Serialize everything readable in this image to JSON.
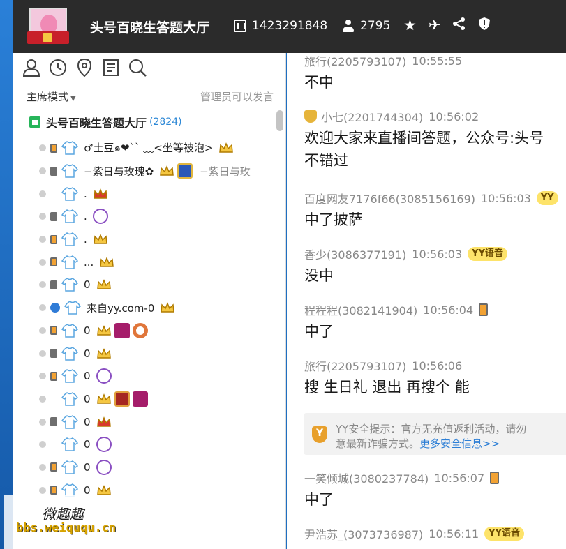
{
  "header": {
    "title": "头号百晓生答题大厅",
    "room_id": "1423291848",
    "online_count": "2795",
    "actions": [
      "favorite-icon",
      "airplane-icon",
      "share-icon",
      "report-icon"
    ]
  },
  "sidebar": {
    "mode": "主席模式",
    "admin_note": "管理员可以发言",
    "channel": {
      "name": "头号百晓生答题大厅",
      "count": "(2824)"
    },
    "users": [
      {
        "device": "orange",
        "name": "♂土豆๑❤`` ﹏<坐等被泡>",
        "badges": [
          "crown-icon"
        ]
      },
      {
        "device": "phone",
        "name": "−紫日与玫瑰✿",
        "badges": [
          "crown-icon",
          "lol-badge"
        ],
        "suffix": "−紫日与玫"
      },
      {
        "device": "none",
        "name": ".",
        "badges": [
          "red-crown-icon"
        ]
      },
      {
        "device": "phone",
        "name": ".",
        "badges": [
          "purple-badge"
        ]
      },
      {
        "device": "orange",
        "name": ".",
        "badges": [
          "crown-icon"
        ]
      },
      {
        "device": "orange",
        "name": "...",
        "badges": [
          "crown-icon"
        ]
      },
      {
        "device": "phone",
        "name": "0",
        "badges": [
          "crown-icon"
        ]
      },
      {
        "device": "yy",
        "name": "来自yy.com-0",
        "badges": [
          "crown-icon"
        ]
      },
      {
        "device": "orange",
        "name": "0",
        "badges": [
          "crown-icon",
          "red-badge",
          "ring-badge"
        ]
      },
      {
        "device": "phone",
        "name": "0",
        "badges": [
          "crown-icon"
        ]
      },
      {
        "device": "orange",
        "name": "0",
        "badges": [
          "purple-badge"
        ]
      },
      {
        "device": "none",
        "name": "0",
        "badges": [
          "crown-icon",
          "gold-badge",
          "red-badge"
        ]
      },
      {
        "device": "phone",
        "name": "0",
        "badges": [
          "red-crown-icon"
        ]
      },
      {
        "device": "none",
        "name": "0",
        "badges": [
          "purple-badge"
        ]
      },
      {
        "device": "orange",
        "name": "0",
        "badges": [
          "purple-badge"
        ]
      },
      {
        "device": "orange",
        "name": "0",
        "badges": [
          "crown-icon"
        ]
      }
    ]
  },
  "watermark": {
    "line1": "微趣趣",
    "line2": "bbs.weiququ.cn"
  },
  "chat": [
    {
      "user": "旅行(2205793107)",
      "time": "10:55:55",
      "text": "不中"
    },
    {
      "user": "小七(2201744304)",
      "time": "10:56:02",
      "text": "欢迎大家来直播间答题，公众号:头号",
      "text2": "不错过",
      "vip": true
    },
    {
      "user": "百度网友7176f66(3085156169)",
      "time": "10:56:03",
      "text": "中了披萨",
      "badge": "YY"
    },
    {
      "user": "香少(3086377191)",
      "time": "10:56:03",
      "text": "没中",
      "badge": "YY语音"
    },
    {
      "user": "程程程(3082141904)",
      "time": "10:56:04",
      "text": "中了",
      "phone": true
    },
    {
      "user": "旅行(2205793107)",
      "time": "10:56:06",
      "text": "搜 生日礼 退出 再搜个 能"
    },
    {
      "user": "一笑倾城(3080237784)",
      "time": "10:56:07",
      "text": "中了",
      "phone": true
    },
    {
      "user": "尹浩苏_(3073736987)",
      "time": "10:56:11",
      "text": "",
      "badge": "YY语音"
    }
  ],
  "security": {
    "line1": "YY安全提示：官方无充值返利活动，请勿",
    "line2_prefix": "意最新诈骗方式。",
    "more": "更多安全信息>>"
  }
}
